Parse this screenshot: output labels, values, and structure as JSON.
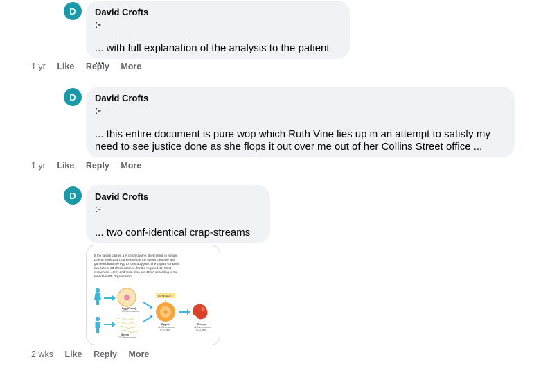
{
  "colors": {
    "avatar_bg": "#1a9aa8",
    "bubble_bg": "#f0f2f5",
    "meta_text": "#65676b"
  },
  "comments": [
    {
      "avatar_letter": "D",
      "author": "David Crofts",
      "lines": [
        ":-",
        "",
        "... with full explanation of the analysis to the patient ..."
      ],
      "time": "1 yr",
      "like": "Like",
      "reply": "Reply",
      "more": "More"
    },
    {
      "avatar_letter": "D",
      "author": "David Crofts",
      "lines": [
        ":-",
        "",
        "... this entire document is pure wop which Ruth Vine lies up in an attempt to satisfy my",
        "need to see justice done as she flops it out over me out of her Collins Street office ..."
      ],
      "time": "1 yr",
      "like": "Like",
      "reply": "Reply",
      "more": "More"
    },
    {
      "avatar_letter": "D",
      "author": "David Crofts",
      "lines": [
        ":-",
        "",
        "... two conf-identical crap-streams ..."
      ],
      "time": "2 wks",
      "like": "Like",
      "reply": "Reply",
      "more": "More",
      "attachment": {
        "text_lines": [
          "If the sperm carries a Y chromosome, it will result in a male.",
          "During fertilization, gametes from the sperm combine with",
          "gametes from the egg to form a zygote. The zygote contains",
          "two sets of 23 chromosomes, for the required 46. Most",
          "women are 46XX and most men are 46XY, according to the",
          "World Health Organization."
        ],
        "labels": {
          "fertilization": "Fertilization",
          "egg": "Egg (Ovum)",
          "egg_sub": "23 Chromosomes",
          "sperm": "Sperm",
          "sperm_sub": "23 Chromosomes",
          "zygote": "Zygote",
          "zygote_sub1": "46 Chromosomes",
          "zygote_sub2": "in 23 pairs",
          "embryo": "Embryo",
          "embryo_sub1": "46 Chromosomes",
          "embryo_sub2": "in 23 pairs"
        }
      }
    }
  ]
}
